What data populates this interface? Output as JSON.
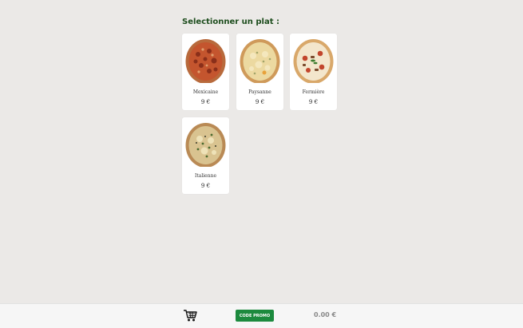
{
  "header": {
    "title": "Selectionner un plat :"
  },
  "menu": {
    "items": [
      {
        "name": "Mexicaine",
        "price": "9 €",
        "image": "pizza-mexicaine-photo"
      },
      {
        "name": "Paysanne",
        "price": "9 €",
        "image": "pizza-paysanne-photo"
      },
      {
        "name": "Fermière",
        "price": "9 €",
        "image": "pizza-fermiere-photo"
      },
      {
        "name": "Italienne",
        "price": "9 €",
        "image": "pizza-italienne-photo"
      }
    ]
  },
  "footer": {
    "cart_icon": "cart-icon",
    "promo_label": "CODE PROMO",
    "total": "0.00 €"
  },
  "colors": {
    "accent_green": "#1c8a3e",
    "title_green": "#1d4d1d",
    "background": "#ebe9e7"
  }
}
